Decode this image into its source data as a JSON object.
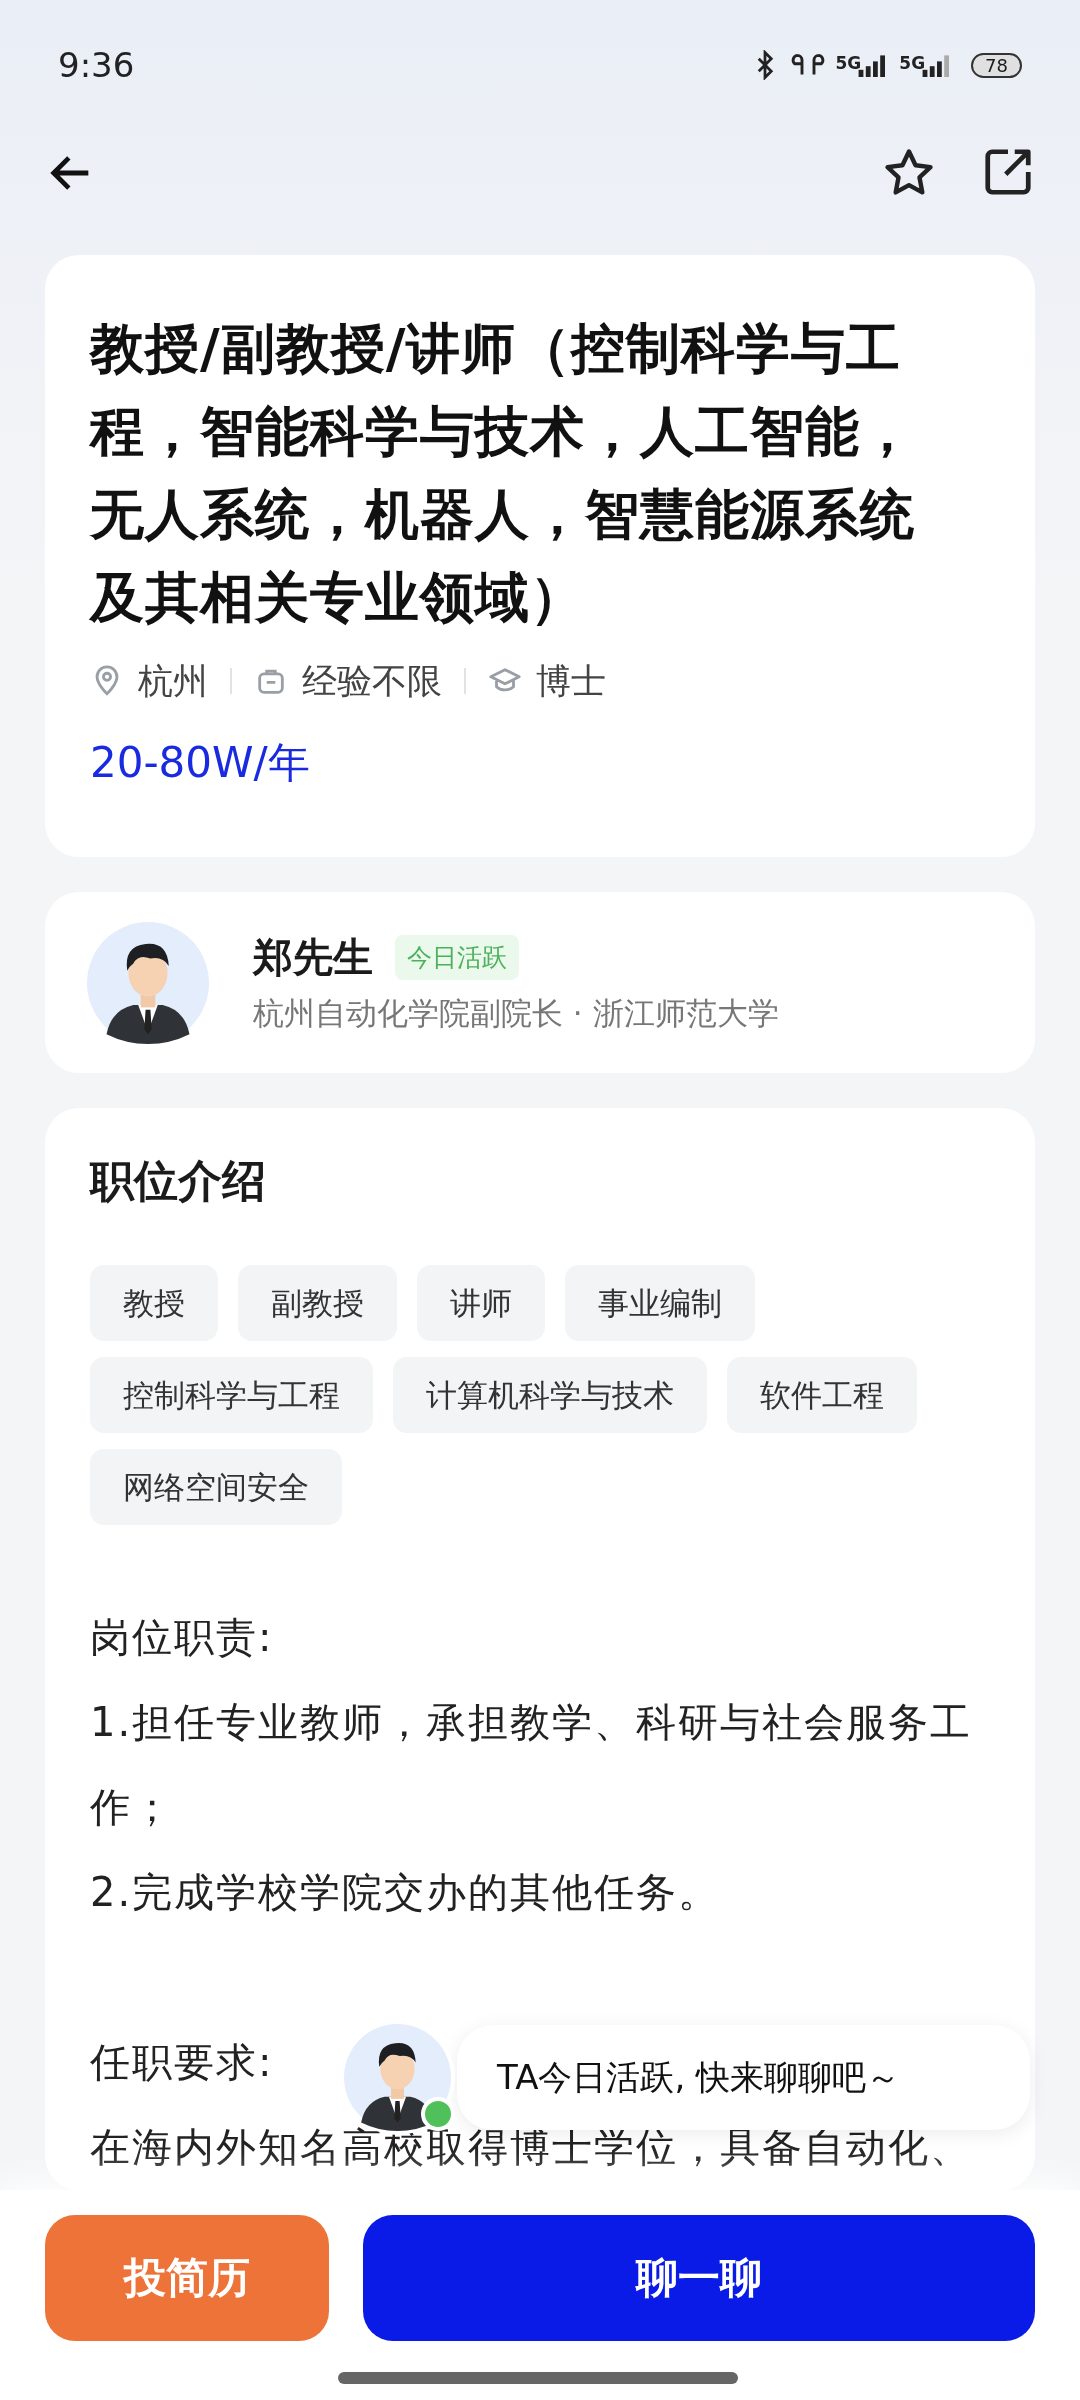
{
  "status_bar": {
    "time": "9:36",
    "network_1": "5G",
    "network_2": "5G",
    "battery": "78"
  },
  "job": {
    "title": "教授/副教授/讲师（控制科学与工程，智能科学与技术，人工智能，无人系统，机器人，智慧能源系统及其相关专业领域）",
    "meta": [
      {
        "kind": "location",
        "text": "杭州"
      },
      {
        "kind": "experience",
        "text": "经验不限"
      },
      {
        "kind": "degree",
        "text": "博士"
      }
    ],
    "salary": "20-80W/年"
  },
  "recruiter": {
    "name": "郑先生",
    "badge": "今日活跃",
    "position": "杭州自动化学院副院长 · 浙江师范大学"
  },
  "description": {
    "heading": "职位介绍",
    "tags": [
      "教授",
      "副教授",
      "讲师",
      "事业编制",
      "控制科学与工程",
      "计算机科学与技术",
      "软件工程",
      "网络空间安全"
    ],
    "sections": [
      {
        "heading": "岗位职责:",
        "lines": [
          "1.担任专业教师，承担教学、科研与社会服务工作；",
          "2.完成学校学院交办的其他任务。"
        ]
      },
      {
        "heading": "任职要求:",
        "lines": [
          "在海内外知名高校取得博士学位，具备自动化、"
        ]
      }
    ]
  },
  "chat_prompt": {
    "text": "TA今日活跃, 快来聊聊吧～",
    "online": true
  },
  "actions": {
    "apply": "投简历",
    "chat": "聊一聊"
  }
}
